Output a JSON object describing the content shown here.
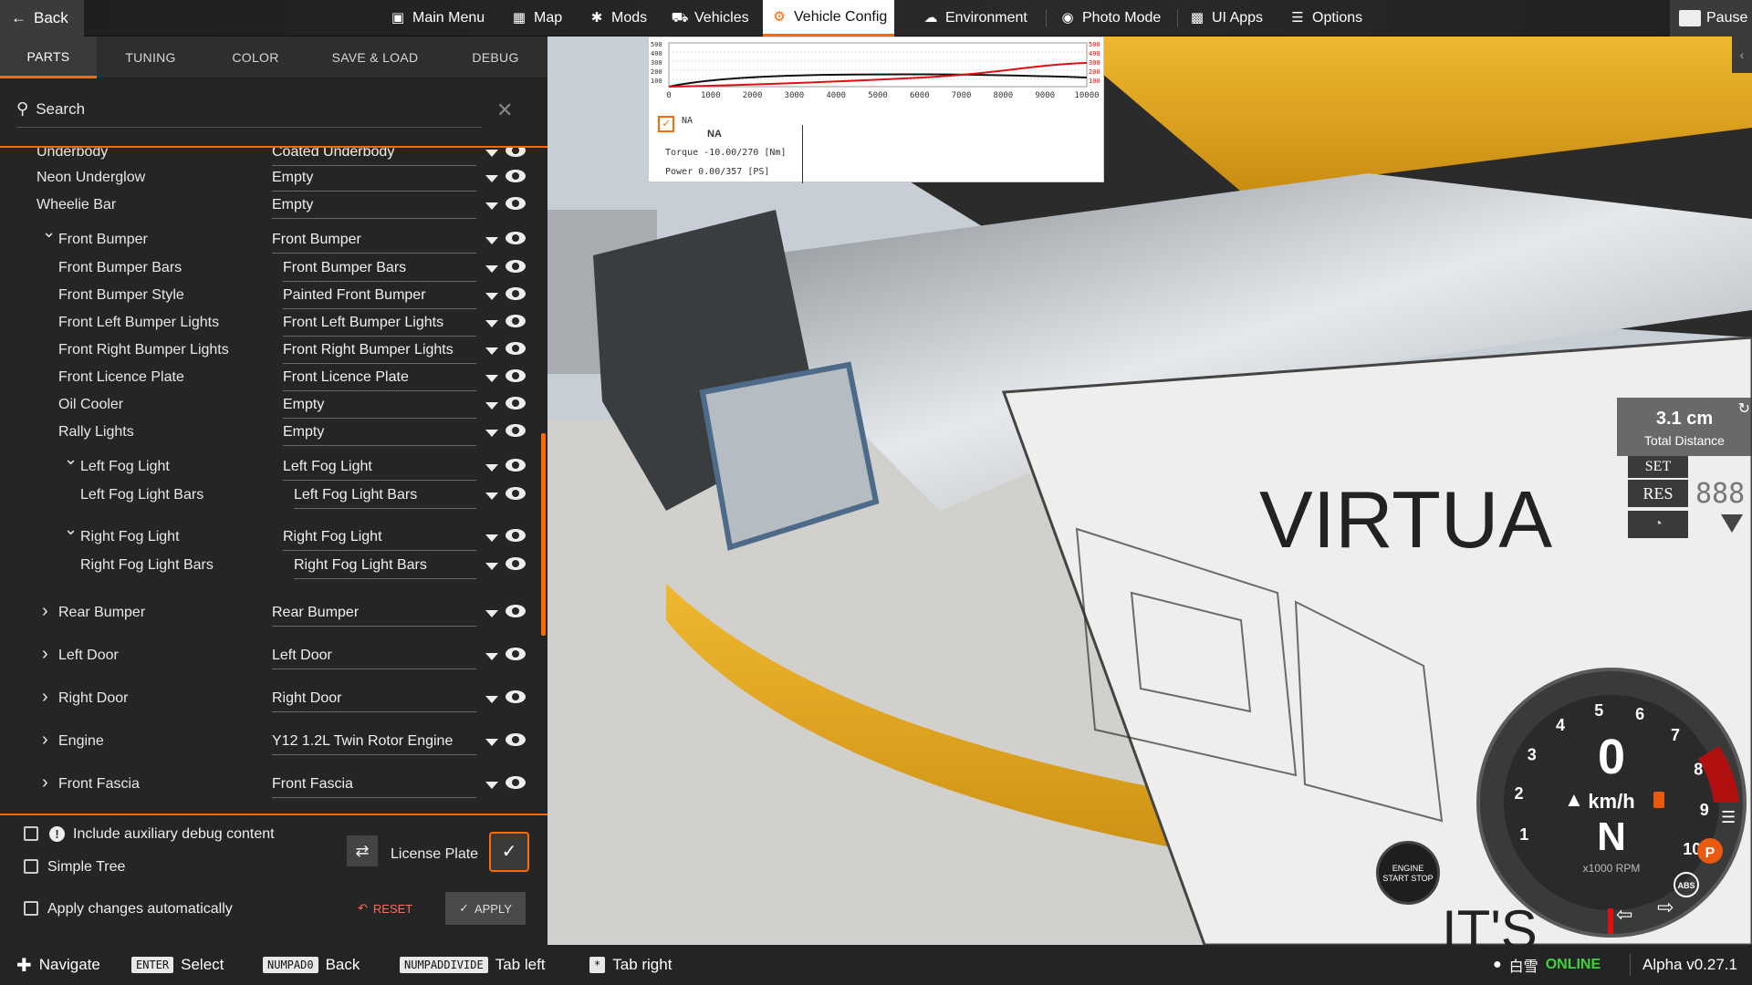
{
  "topbar": {
    "back_label": "Back",
    "items": [
      {
        "label": "Main Menu",
        "icon": "main-menu-icon"
      },
      {
        "label": "Map",
        "icon": "map-icon"
      },
      {
        "label": "Mods",
        "icon": "puzzle-icon"
      },
      {
        "label": "Vehicles",
        "icon": "car-icon"
      },
      {
        "label": "Vehicle Config",
        "icon": "engine-icon"
      },
      {
        "label": "Environment",
        "icon": "weather-icon"
      },
      {
        "label": "Photo Mode",
        "icon": "camera-icon"
      },
      {
        "label": "UI Apps",
        "icon": "ui-apps-icon"
      },
      {
        "label": "Options",
        "icon": "sliders-icon"
      }
    ],
    "pause_label": "Pause",
    "accent": "#ff6a00"
  },
  "tabs": [
    "PARTS",
    "TUNING",
    "COLOR",
    "SAVE & LOAD",
    "DEBUG"
  ],
  "search": {
    "label": "Search"
  },
  "parts": [
    {
      "label": "Underbody",
      "value": "Coated Underbody"
    },
    {
      "label": "Neon Underglow",
      "value": "Empty"
    },
    {
      "label": "Wheelie Bar",
      "value": "Empty"
    },
    {
      "label": "Front Bumper",
      "value": "Front Bumper"
    },
    {
      "label": "Front Bumper Bars",
      "value": "Front Bumper Bars"
    },
    {
      "label": "Front Bumper Style",
      "value": "Painted Front Bumper"
    },
    {
      "label": "Front Left Bumper Lights",
      "value": "Front Left Bumper Lights"
    },
    {
      "label": "Front Right Bumper Lights",
      "value": "Front Right Bumper Lights"
    },
    {
      "label": "Front Licence Plate",
      "value": "Front Licence Plate"
    },
    {
      "label": "Oil Cooler",
      "value": "Empty"
    },
    {
      "label": "Rally Lights",
      "value": "Empty"
    },
    {
      "label": "Left Fog Light",
      "value": "Left Fog Light"
    },
    {
      "label": "Left Fog Light Bars",
      "value": "Left Fog Light Bars"
    },
    {
      "label": "Right Fog Light",
      "value": "Right Fog Light"
    },
    {
      "label": "Right Fog Light Bars",
      "value": "Right Fog Light Bars"
    },
    {
      "label": "Rear Bumper",
      "value": "Rear Bumper"
    },
    {
      "label": "Left Door",
      "value": "Left Door"
    },
    {
      "label": "Right Door",
      "value": "Right Door"
    },
    {
      "label": "Engine",
      "value": "Y12 1.2L Twin Rotor Engine"
    },
    {
      "label": "Front Fascia",
      "value": "Front Fascia"
    }
  ],
  "options": {
    "aux_debug": {
      "label": "Include auxiliary debug content",
      "checked": false
    },
    "simple_tree": {
      "label": "Simple Tree",
      "checked": false
    },
    "apply_auto": {
      "label": "Apply changes automatically",
      "checked": false
    },
    "license_plate": "License Plate",
    "license_plate_checked": true,
    "reset": "RESET",
    "apply": "APPLY"
  },
  "graph": {
    "x_ticks": [
      "0",
      "1000",
      "2000",
      "3000",
      "4000",
      "5000",
      "6000",
      "7000",
      "8000",
      "9000",
      "10000"
    ],
    "y_ticks_left": [
      "500",
      "400",
      "300",
      "200",
      "100"
    ],
    "y_ticks_right": [
      "500",
      "400",
      "300",
      "200",
      "100"
    ],
    "legend_checked": true,
    "legend_label": "NA",
    "name": "NA",
    "torque_label": "Torque",
    "torque_value": "-10.00/270",
    "torque_unit": "[Nm]",
    "power_label": "Power",
    "power_value": "0.00/357",
    "power_unit": "[PS]"
  },
  "hud": {
    "total_distance_value": "3.1 cm",
    "total_distance_label": "Total Distance",
    "set": "SET",
    "res": "RES",
    "speed": "0",
    "speed_unit": "km/h",
    "gear": "N",
    "rpm_unit": "x1000 RPM",
    "rpm_ticks": [
      "1",
      "2",
      "3",
      "4",
      "5",
      "6",
      "7",
      "8",
      "9",
      "10"
    ],
    "start_stop": "ENGINE START STOP",
    "abs": "ABS",
    "park": "P",
    "cruise_digits": "888"
  },
  "scene": {
    "sign_text": "VIRTUA",
    "sign_text2": "IT'S"
  },
  "bottombar": {
    "hints": [
      {
        "key": "",
        "label": "Navigate"
      },
      {
        "key": "ENTER",
        "label": "Select"
      },
      {
        "key": "NUMPAD0",
        "label": "Back"
      },
      {
        "key": "NUMPADDIVIDE",
        "label": "Tab left"
      },
      {
        "key": "*",
        "label": "Tab right"
      }
    ],
    "user": "白雪",
    "status": "ONLINE",
    "version": "Alpha v0.27.1"
  }
}
